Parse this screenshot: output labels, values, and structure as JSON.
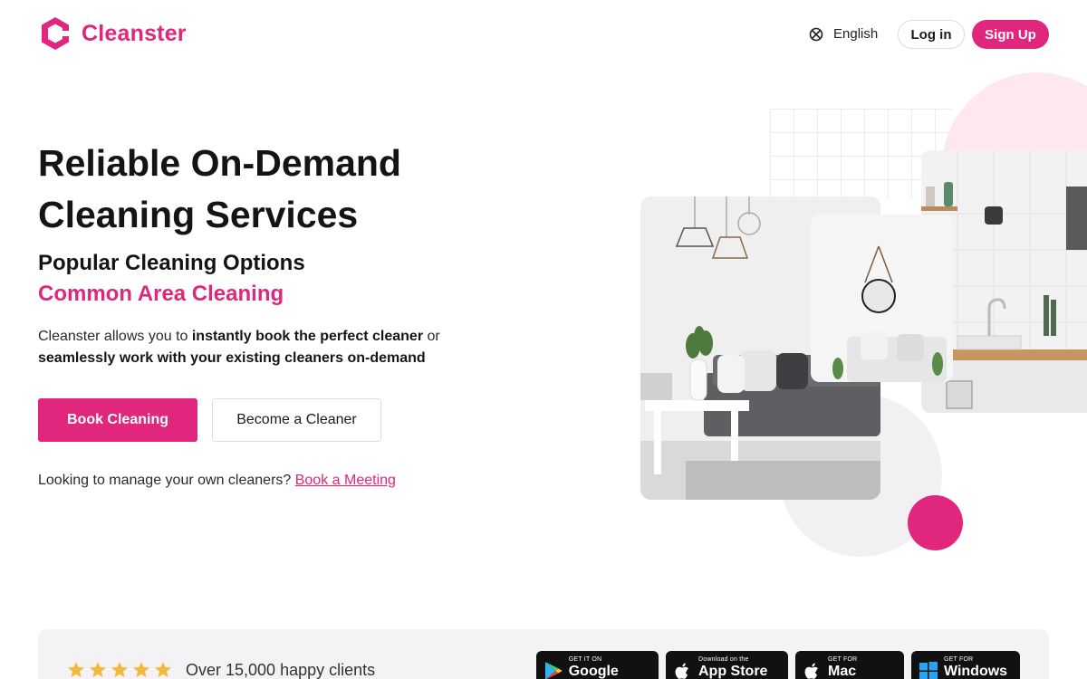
{
  "brand": {
    "name": "Cleanster",
    "color": "#e0267d"
  },
  "header": {
    "language": "English",
    "login_label": "Log in",
    "signup_label": "Sign Up"
  },
  "hero": {
    "title": "Reliable On-Demand Cleaning Services",
    "subtitle": "Popular Cleaning Options",
    "accent": "Common Area Cleaning",
    "desc_part1": "Cleanster allows you to ",
    "desc_bold1": "instantly book the perfect cleaner",
    "desc_part2": " or ",
    "desc_bold2": "seamlessly work with your existing cleaners on-demand",
    "book_label": "Book Cleaning",
    "cleaner_label": "Become a Cleaner",
    "manage_text": "Looking to manage your own cleaners? ",
    "manage_link": "Book a Meeting"
  },
  "social_proof": {
    "rating_stars": 5,
    "clients_text": "Over 15,000 happy clients"
  },
  "stores": [
    {
      "small": "GET IT ON",
      "big": "Google Play",
      "icon": "google-play-icon"
    },
    {
      "small": "Download on the",
      "big": "App Store",
      "icon": "apple-icon"
    },
    {
      "small": "GET FOR",
      "big": "Mac",
      "icon": "apple-icon"
    },
    {
      "small": "GET FOR",
      "big": "Windows",
      "icon": "windows-icon"
    }
  ]
}
